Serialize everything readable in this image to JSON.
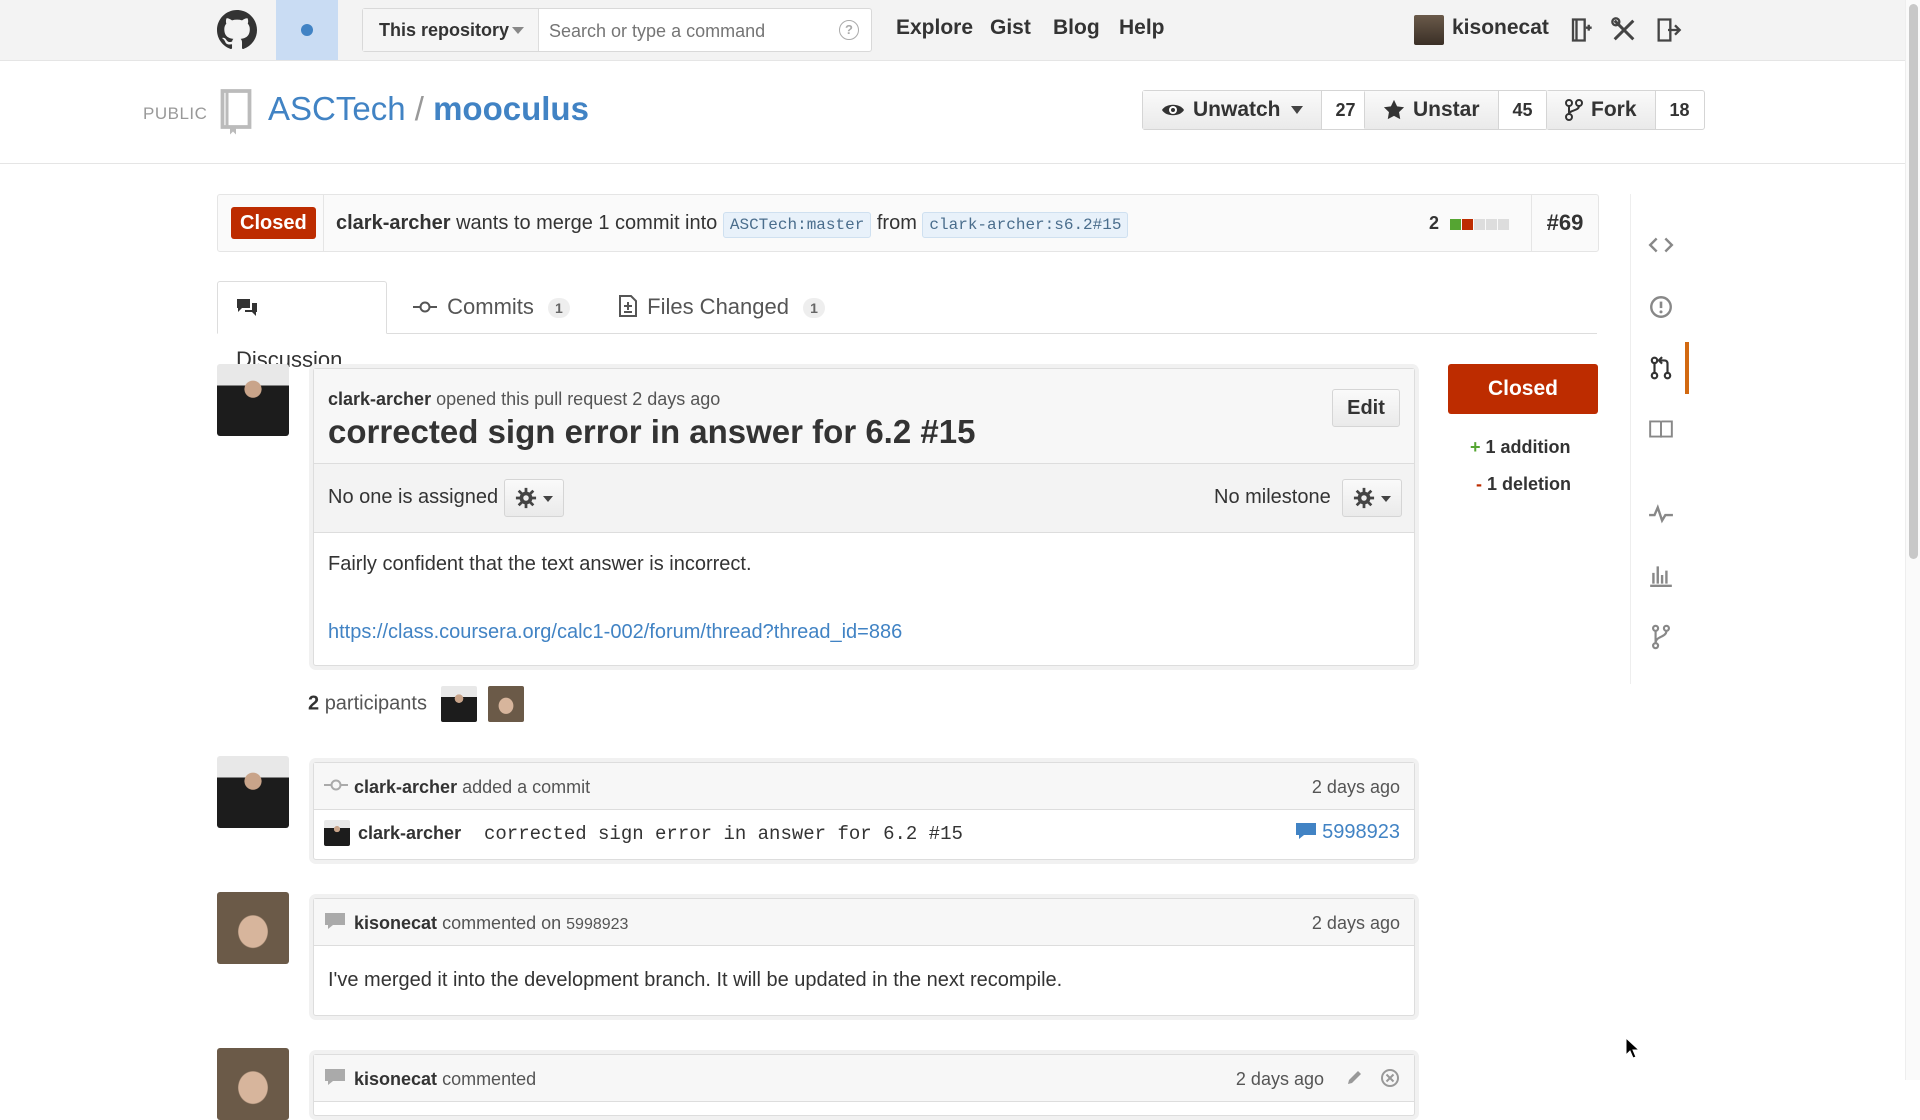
{
  "header": {
    "search_scope": "This repository",
    "search_placeholder": "Search or type a command",
    "search_help": "?",
    "nav": [
      "Explore",
      "Gist",
      "Blog",
      "Help"
    ],
    "username": "kisonecat"
  },
  "repo": {
    "visibility": "PUBLIC",
    "owner": "ASCTech",
    "separator": "/",
    "name": "mooculus",
    "watch_label": "Unwatch",
    "watch_count": "27",
    "star_label": "Unstar",
    "star_count": "45",
    "fork_label": "Fork",
    "fork_count": "18"
  },
  "pr": {
    "state": "Closed",
    "author": "clark-archer",
    "merge_text_1": "wants to merge 1 commit into",
    "base_branch": "ASCTech:master",
    "merge_text_2": "from",
    "head_branch": "clark-archer:s6.2#15",
    "diff_count": "2",
    "number": "#69",
    "tabs": [
      {
        "label": "Discussion"
      },
      {
        "label": "Commits",
        "count": "1"
      },
      {
        "label": "Files Changed",
        "count": "1"
      }
    ],
    "opened_by": "clark-archer",
    "opened_text": "opened this pull request 2 days ago",
    "title": "corrected sign error in answer for 6.2 #15",
    "edit_label": "Edit",
    "assignee_text": "No one is assigned",
    "milestone_text": "No milestone",
    "body_text": "Fairly confident that the text answer is incorrect.",
    "body_link": "https://class.coursera.org/calc1-002/forum/thread?thread_id=886",
    "participants_count": "2",
    "participants_label": "participants",
    "sidebar_state": "Closed",
    "additions_sign": "+",
    "additions": "1 addition",
    "deletions_sign": "-",
    "deletions": "1 deletion"
  },
  "timeline": {
    "commit_event": {
      "author": "clark-archer",
      "action": "added a commit",
      "time": "2 days ago",
      "commit_author": "clark-archer",
      "commit_message": "corrected sign error in answer for 6.2 #15",
      "sha": "5998923"
    },
    "comment1": {
      "author": "kisonecat",
      "action": "commented on",
      "target": "5998923",
      "time": "2 days ago",
      "body": "I've merged it into the development branch. It will be updated in the next recompile."
    },
    "comment2": {
      "author": "kisonecat",
      "action": "commented",
      "time": "2 days ago"
    }
  },
  "colors": {
    "closed": "#bd2c00",
    "link": "#4183c4",
    "addition": "#55a532",
    "deletion": "#bd2c00",
    "rail_active": "#d26911"
  }
}
